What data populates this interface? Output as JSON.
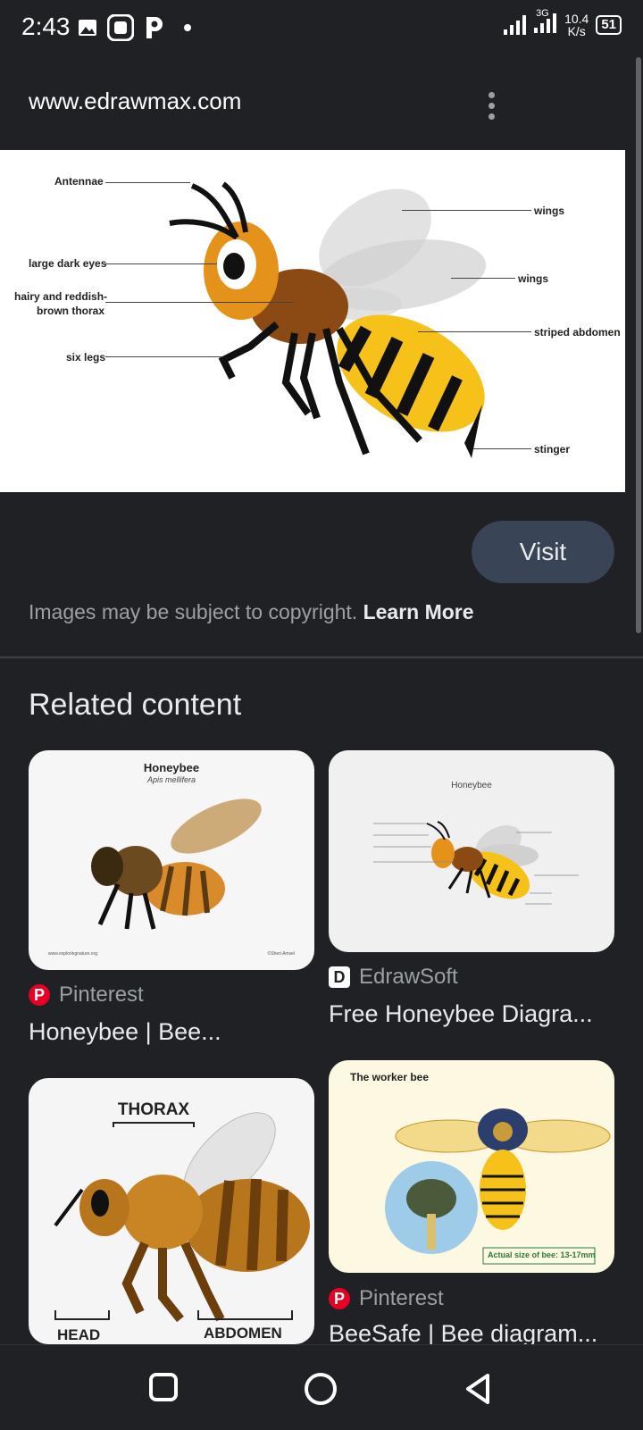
{
  "status": {
    "time": "2:43",
    "net_type": "3G",
    "speed_value": "10.4",
    "speed_unit": "K/s",
    "battery": "51"
  },
  "browser": {
    "url": "www.edrawmax.com"
  },
  "hero": {
    "labels": {
      "antennae": "Antennae",
      "eyes": "large dark eyes",
      "thorax_1": "hairy and reddish-",
      "thorax_2": "brown thorax",
      "legs": "six legs",
      "wings_1": "wings",
      "wings_2": "wings",
      "abdomen": "striped abdomen",
      "stinger": "stinger"
    }
  },
  "actions": {
    "visit_label": "Visit",
    "copyright_text": "Images may be subject to copyright. ",
    "learn_more": "Learn More"
  },
  "related": {
    "heading": "Related content",
    "items": [
      {
        "source": "Pinterest",
        "title": "Honeybee | Bee...",
        "thumb_title": "Honeybee",
        "thumb_subtitle": "Apis mellifera",
        "thumb_footer_left": "www.exploringnature.org",
        "thumb_footer_right": "©Sheri Amsel"
      },
      {
        "source": "EdrawSoft",
        "title": "Free Honeybee Diagra...",
        "thumb_title": "Honeybee"
      },
      {
        "thumb_thorax": "THORAX",
        "thumb_head": "HEAD",
        "thumb_abdomen": "ABDOMEN"
      },
      {
        "source": "Pinterest",
        "title": "BeeSafe | Bee diagram...",
        "thumb_title": "The worker bee",
        "thumb_actual_size": "Actual size of bee: 13-17mm"
      }
    ]
  },
  "colors": {
    "background": "#202124",
    "visit_button": "#394457",
    "pinterest": "#e60023"
  }
}
